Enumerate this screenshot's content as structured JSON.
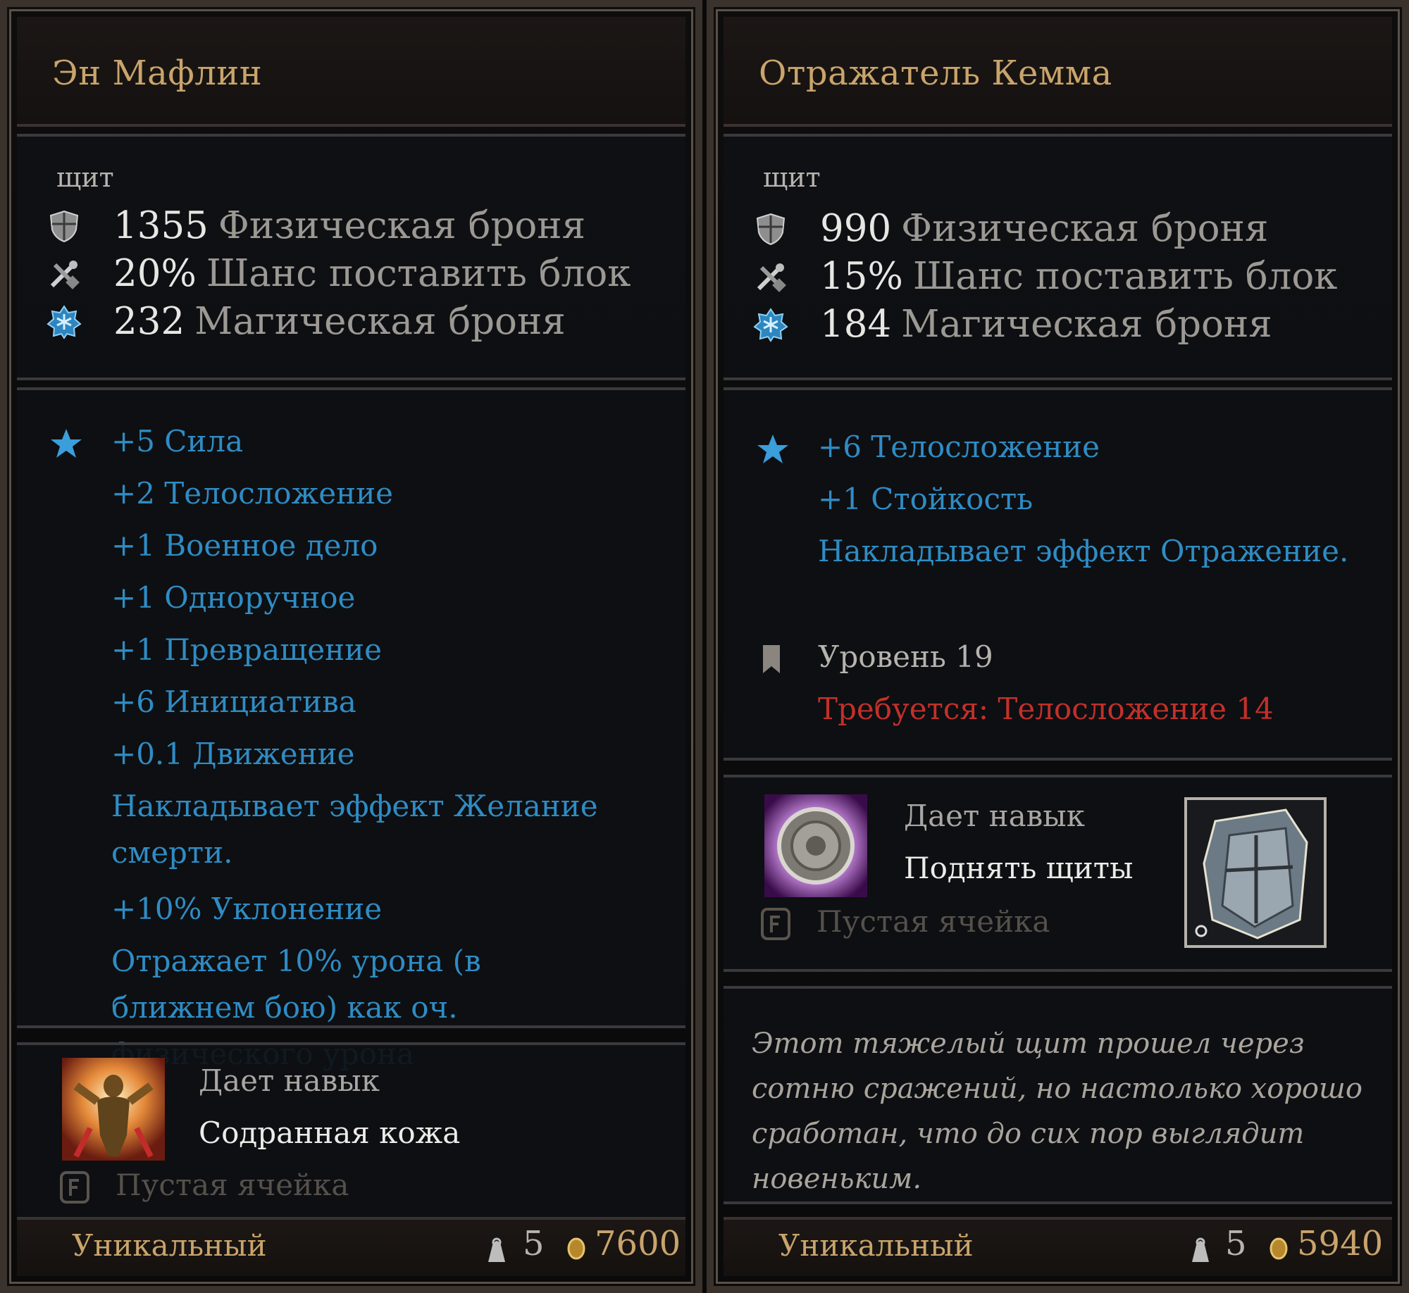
{
  "left": {
    "title": "Эн Мафлин",
    "type": "щит",
    "stats": [
      {
        "icon": "shield-icon",
        "value": "1355",
        "label": "Физическая броня"
      },
      {
        "icon": "block-icon",
        "value": "20%",
        "label": "Шанс поставить блок"
      },
      {
        "icon": "magic-armor-icon",
        "value": "232",
        "label": "Магическая броня"
      }
    ],
    "bonuses": [
      "+5 Сила",
      "+2 Телосложение",
      "+1 Военное дело",
      "+1 Одноручное",
      "+1 Превращение",
      "+6 Инициатива",
      "+0.1 Движение",
      "Накладывает эффект Желание смерти.",
      "+10% Уклонение",
      "Отражает 10% урона (в ближнем бою)  как оч. физического урона"
    ],
    "skill_label": "Дает навык",
    "skill_name": "Содранная кожа",
    "empty_slot": "Пустая ячейка",
    "rarity": "Уникальный",
    "weight": "5",
    "gold": "7600"
  },
  "right": {
    "title": "Отражатель Кемма",
    "type": "щит",
    "stats": [
      {
        "icon": "shield-icon",
        "value": "990",
        "label": "Физическая броня"
      },
      {
        "icon": "block-icon",
        "value": "15%",
        "label": "Шанс поставить блок"
      },
      {
        "icon": "magic-armor-icon",
        "value": "184",
        "label": "Магическая броня"
      }
    ],
    "bonuses": [
      "+6 Телосложение",
      "+1 Стойкость",
      "Накладывает эффект Отражение."
    ],
    "level": "Уровень  19",
    "requirement": "Требуется: Телосложение 14",
    "skill_label": "Дает навык",
    "skill_name": "Поднять щиты",
    "empty_slot": "Пустая ячейка",
    "description": "Этот тяжелый щит прошел через сотню сражений, но настолько хорошо сработан, что до сих пор выглядит новеньким.",
    "rarity": "Уникальный",
    "weight": "5",
    "gold": "5940"
  }
}
